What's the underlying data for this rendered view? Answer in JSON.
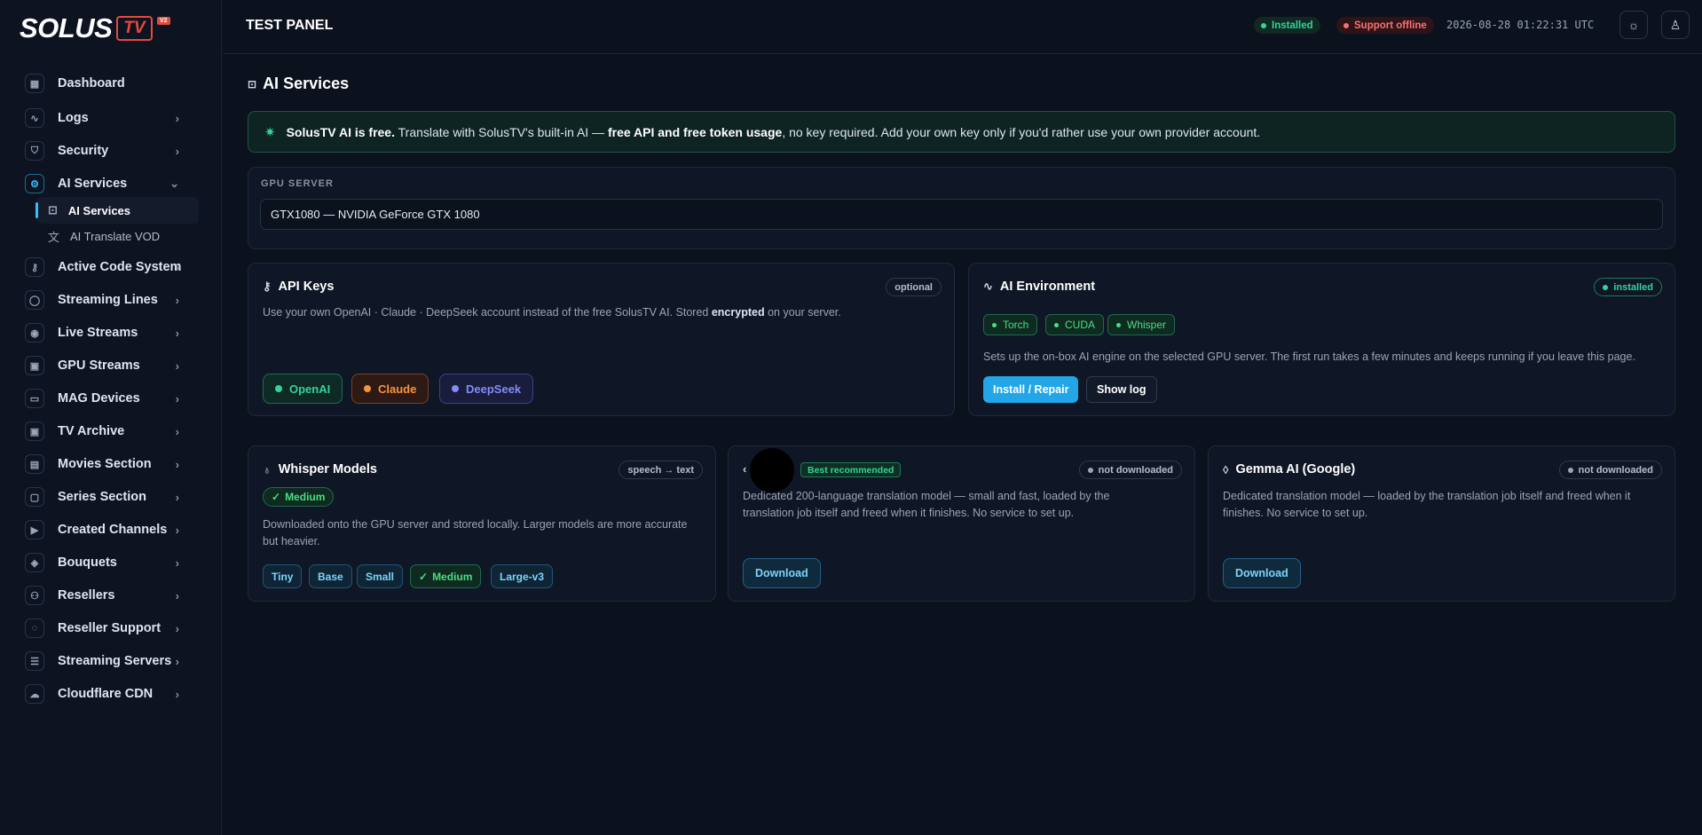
{
  "brand": {
    "name": "SOLUS",
    "tv": "TV",
    "version": "V2"
  },
  "sidebar": {
    "items": [
      {
        "label": "Dashboard",
        "icon": "grid-icon"
      },
      {
        "label": "Logs",
        "icon": "activity-icon"
      },
      {
        "label": "Security",
        "icon": "shield-icon"
      },
      {
        "label": "AI Services",
        "icon": "cpu-gear-icon"
      },
      {
        "label": "Active Code System",
        "icon": "key-icon"
      },
      {
        "label": "Streaming Lines",
        "icon": "user-icon"
      },
      {
        "label": "Live Streams",
        "icon": "broadcast-icon"
      },
      {
        "label": "GPU Streams",
        "icon": "chip-icon"
      },
      {
        "label": "MAG Devices",
        "icon": "device-icon"
      },
      {
        "label": "TV Archive",
        "icon": "archive-icon"
      },
      {
        "label": "Movies Section",
        "icon": "film-icon"
      },
      {
        "label": "Series Section",
        "icon": "tv-icon"
      },
      {
        "label": "Created Channels",
        "icon": "play-icon"
      },
      {
        "label": "Bouquets",
        "icon": "layers-icon"
      },
      {
        "label": "Resellers",
        "icon": "users-icon"
      },
      {
        "label": "Reseller Support",
        "icon": "chat-icon"
      },
      {
        "label": "Streaming Servers",
        "icon": "server-icon"
      },
      {
        "label": "Cloudflare CDN",
        "icon": "cloud-icon"
      }
    ],
    "subitems": [
      {
        "label": "AI Services",
        "icon": "robot-icon"
      },
      {
        "label": "AI Translate VOD",
        "icon": "translate-icon"
      }
    ]
  },
  "topbar": {
    "title": "TEST PANEL",
    "installed": "Installed",
    "support": "Support offline",
    "timestamp": "2026-08-28 01:22:31 UTC"
  },
  "page": {
    "title": "AI Services",
    "banner": {
      "bold": "SolusTV AI is free.",
      "t1": " Translate with SolusTV's built-in AI — ",
      "bold2": "free API and free token usage",
      "t2": ", no key required. Add your own key only if you'd rather use your own provider account."
    },
    "gpu": {
      "label": "GPU SERVER",
      "value": "GTX1080 — NVIDIA GeForce GTX 1080"
    },
    "api_keys": {
      "title": "API Keys",
      "badge": "optional",
      "desc1": "Use your own OpenAI · Claude · DeepSeek account instead of the free SolusTV AI. Stored ",
      "desc_bold": "encrypted",
      "desc2": " on your server.",
      "providers": [
        "OpenAI",
        "Claude",
        "DeepSeek"
      ]
    },
    "ai_env": {
      "title": "AI Environment",
      "badge": "installed",
      "tags": [
        "Torch",
        "CUDA",
        "Whisper"
      ],
      "desc": "Sets up the on-box AI engine on the selected GPU server. The first run takes a few minutes and keeps running if you leave this page.",
      "install": "Install / Repair",
      "log": "Show log"
    },
    "whisper": {
      "title": "Whisper Models",
      "badge": "speech → text",
      "selected": "Medium",
      "desc": "Downloaded onto the GPU server and stored locally. Larger models are more accurate but heavier.",
      "models": [
        "Tiny",
        "Base",
        "Small",
        "Medium",
        "Large-v3"
      ]
    },
    "nllb": {
      "title": "‹",
      "recommended": "Best recommended",
      "badge": "not downloaded",
      "desc": "Dedicated 200-language translation model — small and fast, loaded by the translation job itself and freed when it finishes. No service to set up.",
      "download": "Download"
    },
    "gemma": {
      "title": "Gemma AI (Google)",
      "badge": "not downloaded",
      "desc": "Dedicated translation model — loaded by the translation job itself and freed when it finishes. No service to set up.",
      "download": "Download"
    }
  }
}
